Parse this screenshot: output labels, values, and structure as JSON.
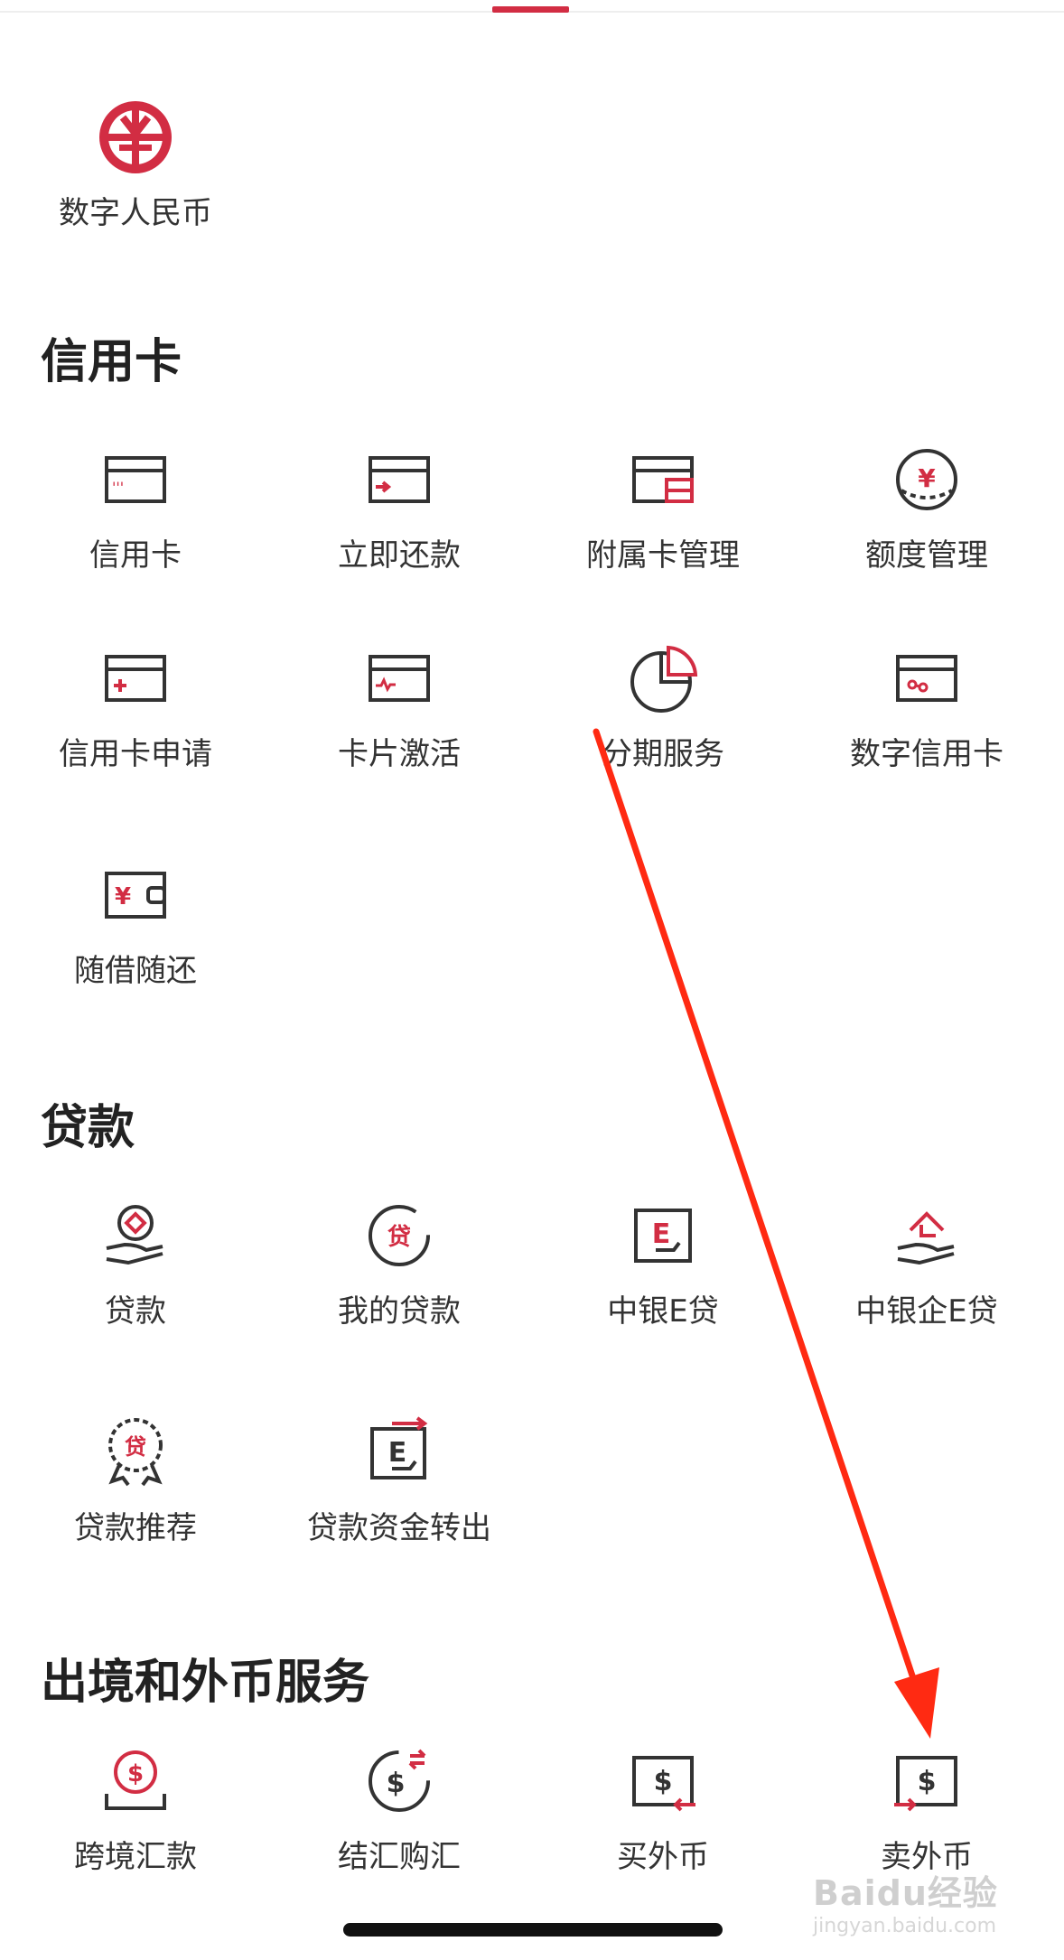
{
  "colors": {
    "accent": "#d22d43",
    "icon_stroke": "#333333",
    "annotation_arrow": "#ff2a12"
  },
  "digital_rmb": {
    "label": "数字人民币",
    "icon": "digital-rmb-logo-icon"
  },
  "credit_card": {
    "title": "信用卡",
    "items": [
      {
        "label": "信用卡",
        "icon": "credit-card-icon"
      },
      {
        "label": "立即还款",
        "icon": "repay-card-icon"
      },
      {
        "label": "附属卡管理",
        "icon": "supplementary-card-icon"
      },
      {
        "label": "额度管理",
        "icon": "credit-limit-icon"
      },
      {
        "label": "信用卡申请",
        "icon": "card-apply-icon"
      },
      {
        "label": "卡片激活",
        "icon": "card-activate-icon"
      },
      {
        "label": "分期服务",
        "icon": "pie-chart-icon"
      },
      {
        "label": "数字信用卡",
        "icon": "digital-card-icon"
      },
      {
        "label": "随借随还",
        "icon": "wallet-icon"
      }
    ]
  },
  "loans": {
    "title": "贷款",
    "items": [
      {
        "label": "贷款",
        "icon": "loan-hand-icon"
      },
      {
        "label": "我的贷款",
        "icon": "my-loan-icon",
        "glyph": "贷"
      },
      {
        "label": "中银E贷",
        "icon": "e-loan-icon",
        "glyph": "E"
      },
      {
        "label": "中银企E贷",
        "icon": "enterprise-loan-icon"
      },
      {
        "label": "贷款推荐",
        "icon": "loan-badge-icon",
        "glyph": "贷"
      },
      {
        "label": "贷款资金转出",
        "icon": "loan-transfer-icon",
        "glyph": "E"
      }
    ]
  },
  "forex": {
    "title": "出境和外币服务",
    "items": [
      {
        "label": "跨境汇款",
        "icon": "cross-border-remit-icon",
        "glyph": "$"
      },
      {
        "label": "结汇购汇",
        "icon": "currency-exchange-icon",
        "glyph": "$"
      },
      {
        "label": "买外币",
        "icon": "buy-currency-icon",
        "glyph": "$"
      },
      {
        "label": "卖外币",
        "icon": "sell-currency-icon",
        "glyph": "$"
      }
    ]
  },
  "watermark": {
    "main": "Baidu经验",
    "sub": "jingyan.baidu.com"
  },
  "credit_glyph": "¥",
  "credit_dots": "'''",
  "wallet_glyph": "¥"
}
